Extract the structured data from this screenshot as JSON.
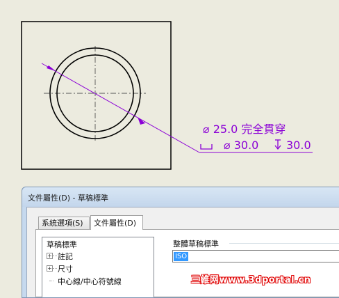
{
  "drawing": {
    "callout_line1": "⌀ 25.0 完全貫穿",
    "callout_line2_diameter": "⌀ 30.0",
    "callout_line2_depth": "30.0",
    "callout_color": "#8b00d6"
  },
  "dialog": {
    "title": "文件屬性(D) - 草稿標準",
    "tabs": [
      {
        "label": "系統選項(S)",
        "active": false
      },
      {
        "label": "文件屬性(D)",
        "active": true
      }
    ],
    "tree": {
      "root": "草稿標準",
      "items": [
        "註記",
        "尺寸",
        "中心線/中心符號線"
      ]
    },
    "overall_standard": {
      "group_label": "整體草稿標準",
      "selected_value": "ISO"
    }
  },
  "watermark": {
    "text": "三維网www.3dportal.cn"
  }
}
